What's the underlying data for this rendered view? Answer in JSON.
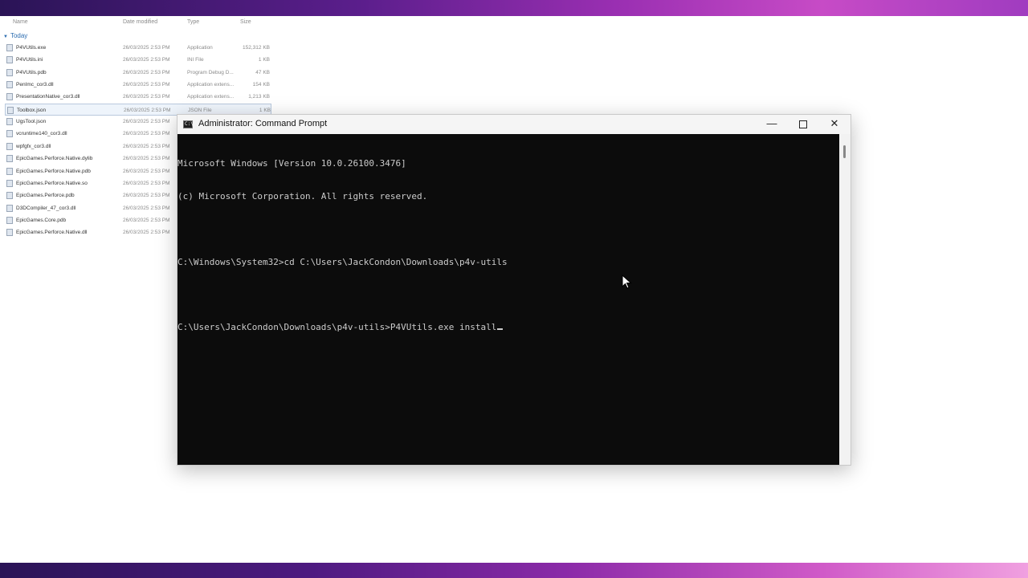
{
  "explorer": {
    "columns": {
      "name": "Name",
      "date": "Date modified",
      "type": "Type",
      "size": "Size"
    },
    "group": "Today",
    "files": [
      {
        "name": "P4VUtils.exe",
        "date": "26/03/2025 2:53 PM",
        "type": "Application",
        "size": "152,312 KB"
      },
      {
        "name": "P4VUtils.ini",
        "date": "26/03/2025 2:53 PM",
        "type": "INI File",
        "size": "1 KB"
      },
      {
        "name": "P4VUtils.pdb",
        "date": "26/03/2025 2:53 PM",
        "type": "Program Debug D...",
        "size": "47 KB"
      },
      {
        "name": "PenImc_cor3.dll",
        "date": "26/03/2025 2:53 PM",
        "type": "Application extens...",
        "size": "154 KB"
      },
      {
        "name": "PresentationNative_cor3.dll",
        "date": "26/03/2025 2:53 PM",
        "type": "Application extens...",
        "size": "1,213 KB"
      },
      {
        "name": "Toolbox.json",
        "date": "26/03/2025 2:53 PM",
        "type": "JSON File",
        "size": "1 KB"
      },
      {
        "name": "UgsTool.json",
        "date": "26/03/2025 2:53 PM",
        "type": "",
        "size": ""
      },
      {
        "name": "vcruntime140_cor3.dll",
        "date": "26/03/2025 2:53 PM",
        "type": "",
        "size": ""
      },
      {
        "name": "wpfgfx_cor3.dll",
        "date": "26/03/2025 2:53 PM",
        "type": "",
        "size": ""
      },
      {
        "name": "EpicGames.Perforce.Native.dylib",
        "date": "26/03/2025 2:53 PM",
        "type": "",
        "size": ""
      },
      {
        "name": "EpicGames.Perforce.Native.pdb",
        "date": "26/03/2025 2:53 PM",
        "type": "",
        "size": ""
      },
      {
        "name": "EpicGames.Perforce.Native.so",
        "date": "26/03/2025 2:53 PM",
        "type": "",
        "size": ""
      },
      {
        "name": "EpicGames.Perforce.pdb",
        "date": "26/03/2025 2:53 PM",
        "type": "",
        "size": ""
      },
      {
        "name": "D3DCompiler_47_cor3.dll",
        "date": "26/03/2025 2:53 PM",
        "type": "",
        "size": ""
      },
      {
        "name": "EpicGames.Core.pdb",
        "date": "26/03/2025 2:53 PM",
        "type": "",
        "size": ""
      },
      {
        "name": "EpicGames.Perforce.Native.dll",
        "date": "26/03/2025 2:53 PM",
        "type": "",
        "size": ""
      }
    ]
  },
  "cmd": {
    "title": "Administrator: Command Prompt",
    "icon_label": "C:\\",
    "minimize_glyph": "—",
    "close_glyph": "✕",
    "lines": [
      "Microsoft Windows [Version 10.0.26100.3476]",
      "(c) Microsoft Corporation. All rights reserved.",
      "",
      "C:\\Windows\\System32>cd C:\\Users\\JackCondon\\Downloads\\p4v-utils",
      "",
      "C:\\Users\\JackCondon\\Downloads\\p4v-utils>P4VUtils.exe install"
    ]
  },
  "colors": {
    "terminal_bg": "#0c0c0c",
    "terminal_fg": "#cccccc",
    "accent_band": "#9a2fb2"
  }
}
